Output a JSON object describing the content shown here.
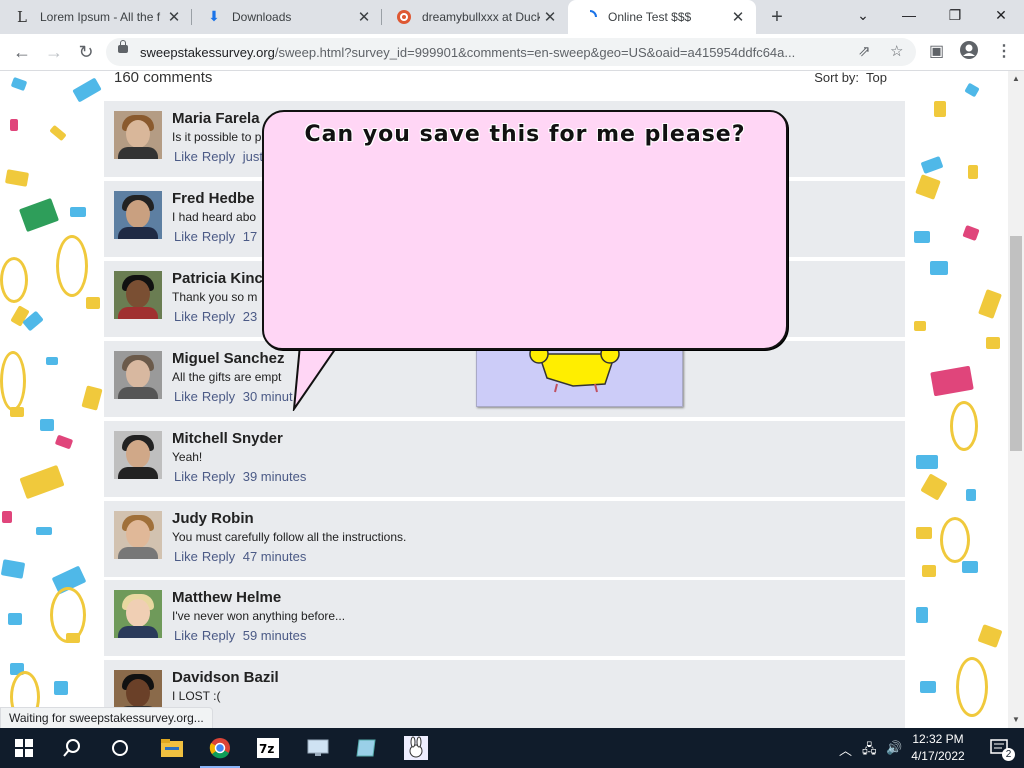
{
  "browser": {
    "tabs": [
      {
        "title": "Lorem Ipsum - All the f",
        "icon": "L"
      },
      {
        "title": "Downloads",
        "icon": "download-icon"
      },
      {
        "title": "dreamybullxxx at Duck",
        "icon": "duckduckgo-icon"
      },
      {
        "title": "Online Test $$$",
        "icon": "loading-icon"
      }
    ],
    "url": {
      "domain": "sweepstakessurvey.org",
      "rest": "/sweep.html?survey_id=999901&comments=en-sweep&geo=US&oaid=a415954ddfc64a..."
    }
  },
  "comments": {
    "count_label": "160 comments",
    "sort_label": "Sort by:",
    "sort_value": "Top",
    "like_label": "Like",
    "reply_label": "Reply",
    "items": [
      {
        "name": "Maria Farela",
        "text": "Is it possible to p",
        "time": "just"
      },
      {
        "name": "Fred Hedbe",
        "text": "I had heard abo",
        "time": "17"
      },
      {
        "name": "Patricia Kinc",
        "text": "Thank you so m",
        "time": "23"
      },
      {
        "name": "Miguel Sanchez",
        "text": "All the gifts are empt",
        "time": "30 minut"
      },
      {
        "name": "Mitchell Snyder",
        "text": "Yeah!",
        "time": "39 minutes"
      },
      {
        "name": "Judy Robin",
        "text": "You must carefully follow all the instructions.",
        "time": "47 minutes"
      },
      {
        "name": "Matthew Helme",
        "text": "I've never won anything before...",
        "time": "59 minutes"
      },
      {
        "name": "Davidson Bazil",
        "text": "I LOST :(",
        "time": ""
      }
    ]
  },
  "popup": {
    "text": "Can you save this for me please?"
  },
  "status_text": "Waiting for sweepstakessurvey.org...",
  "taskbar": {
    "time": "12:32 PM",
    "date": "4/17/2022",
    "notifications": "2"
  },
  "colors": {
    "tab_strip": "#dee1e6",
    "comment_bg": "#e9ebee",
    "link_blue": "#4b5a86",
    "popup_pink": "#ffd6f5",
    "mascot_box": "#ccccf8",
    "taskbar": "#101c2b"
  }
}
